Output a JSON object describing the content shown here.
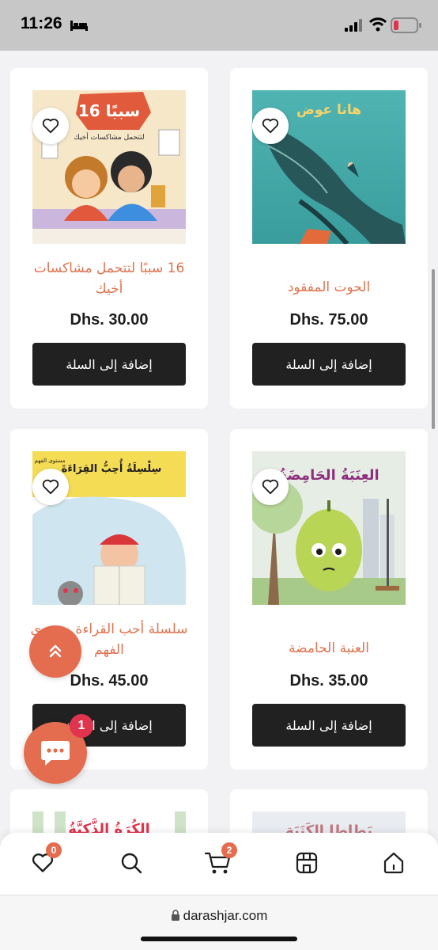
{
  "status_bar": {
    "time": "11:26"
  },
  "products": [
    {
      "title": "16 سببًا لتتحمل مشاكسات أخيك",
      "price": "Dhs. 30.00",
      "button": "إضافة إلى السلة"
    },
    {
      "title": "الحوت المفقود",
      "price": "Dhs. 75.00",
      "button": "إضافة إلى السلة"
    },
    {
      "title": "سلسلة أحب القراءة مستوى الفهم",
      "price": "Dhs. 45.00",
      "button": "إضافة إلى السلة"
    },
    {
      "title": "العنبة الحامضة",
      "price": "Dhs. 35.00",
      "button": "إضافة إلى السلة"
    }
  ],
  "covers": {
    "p1_title": "16 سببًا",
    "p1_subtitle": "لتتحمل مشاكسات أخيك",
    "p2_author": "هانا عوض",
    "p3_title": "سِلْسِلَةُ أُحِبُّ القِرَاءَةَ",
    "p3_level": "مستوى الفهم",
    "p4_title": "العِنَبَةُ الحَامِضَةُ",
    "p5_title": "الكُرَةُ الذَّكِيَّةُ",
    "p6_title": "بَطاطا الكَنَبَة"
  },
  "chat": {
    "badge": "1"
  },
  "bottom_nav": {
    "wishlist_count": "0",
    "cart_count": "2"
  },
  "browser": {
    "url": "darashjar.com"
  },
  "colors": {
    "accent": "#e46c4f",
    "button": "#212121",
    "title": "#e0734f"
  }
}
